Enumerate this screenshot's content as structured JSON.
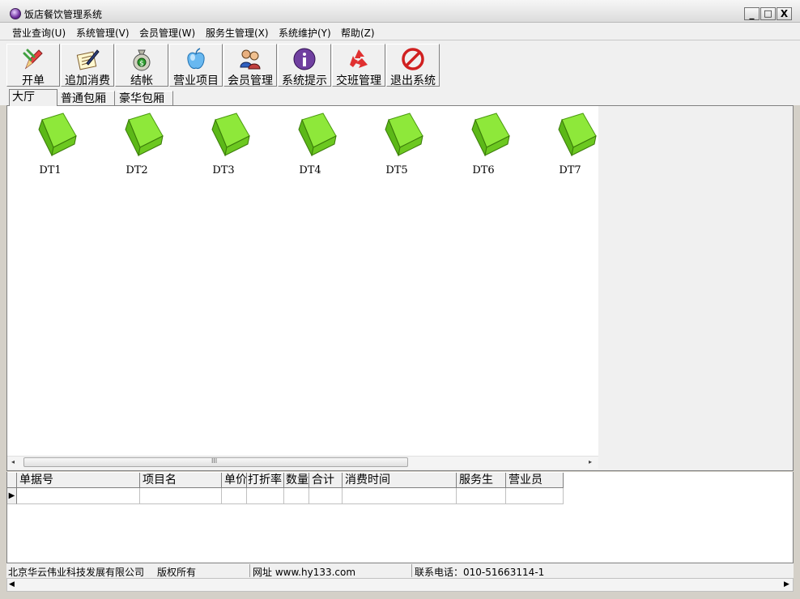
{
  "window": {
    "title": "饭店餐饮管理系统",
    "minimize": "_",
    "maximize": "□",
    "close": "X"
  },
  "menu": [
    {
      "label": "营业查询(U)"
    },
    {
      "label": "系统管理(V)"
    },
    {
      "label": "会员管理(W)"
    },
    {
      "label": "服务生管理(X)"
    },
    {
      "label": "系统维护(Y)"
    },
    {
      "label": "帮助(Z)"
    }
  ],
  "toolbar": [
    {
      "label": "开单",
      "icon": "pencil-icon"
    },
    {
      "label": "追加消费",
      "icon": "notepad-icon"
    },
    {
      "label": "结帐",
      "icon": "money-bag-icon"
    },
    {
      "label": "营业项目",
      "icon": "apple-icon"
    },
    {
      "label": "会员管理",
      "icon": "people-icon"
    },
    {
      "label": "系统提示",
      "icon": "info-icon"
    },
    {
      "label": "交班管理",
      "icon": "recycle-icon"
    },
    {
      "label": "退出系统",
      "icon": "no-entry-icon"
    }
  ],
  "tabs": [
    {
      "label": "大厅",
      "active": true
    },
    {
      "label": "普通包厢",
      "active": false
    },
    {
      "label": "豪华包厢",
      "active": false
    }
  ],
  "tables": [
    {
      "name": "DT1"
    },
    {
      "name": "DT2"
    },
    {
      "name": "DT3"
    },
    {
      "name": "DT4"
    },
    {
      "name": "DT5"
    },
    {
      "name": "DT6"
    },
    {
      "name": "DT7"
    }
  ],
  "scrollbar": {
    "left_arrow": "◂",
    "right_arrow": "▸",
    "grip": "III"
  },
  "grid": {
    "columns": [
      "单据号",
      "项目名",
      "单价",
      "打折率",
      "数量",
      "合计",
      "消费时间",
      "服务生",
      "营业员"
    ],
    "row_indicator": "▶"
  },
  "status": {
    "company": "北京华云伟业科技发展有限公司",
    "copyright": "版权所有",
    "website": "网址 www.hy133.com",
    "phone": "联系电话：010-51663114-1"
  },
  "bottom_scroll": {
    "left_arrow": "◀",
    "right_arrow": "▶"
  },
  "colors": {
    "table_icon": "#7ed321",
    "toolbar_bg": "#f0f0f0",
    "window_bg": "#d4d0c8"
  }
}
